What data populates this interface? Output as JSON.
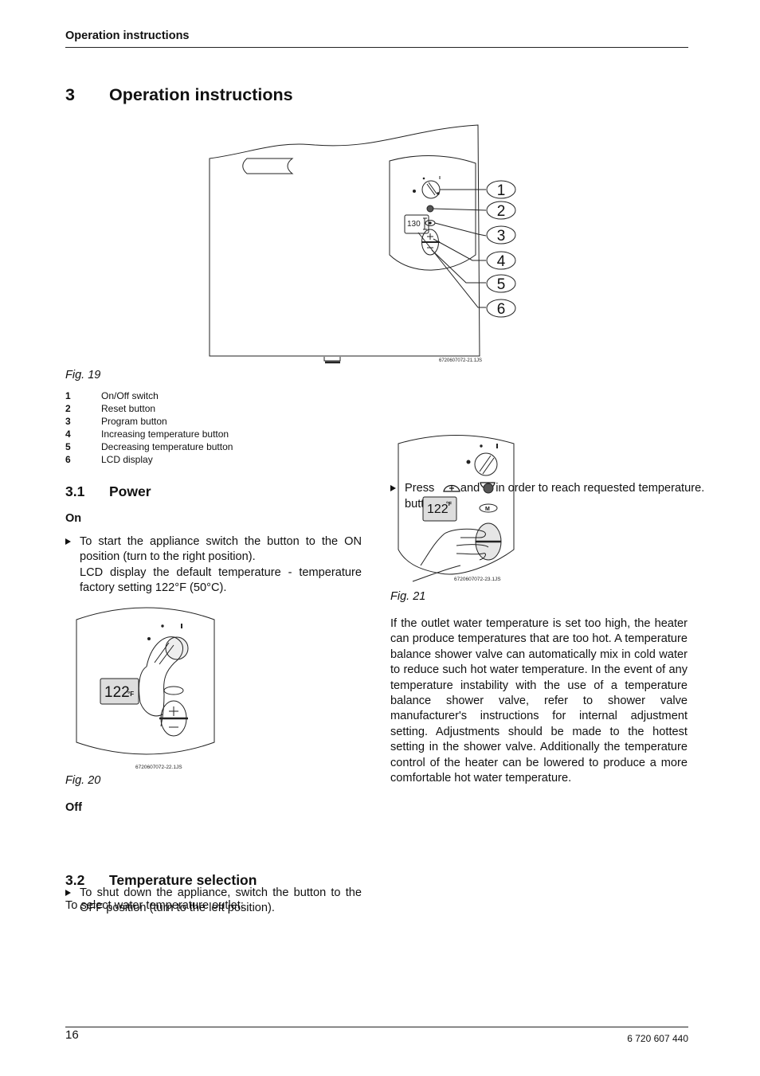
{
  "header": {
    "running_title": "Operation instructions"
  },
  "chapter": {
    "number": "3",
    "title": "Operation instructions"
  },
  "fig19": {
    "caption": "Fig. 19",
    "code": "6720607072-21.1JS",
    "lcd_value": "130",
    "callouts": [
      "1",
      "2",
      "3",
      "4",
      "5",
      "6"
    ],
    "legend": [
      {
        "key": "1",
        "label": "On/Off switch"
      },
      {
        "key": "2",
        "label": "Reset button"
      },
      {
        "key": "3",
        "label": "Program button"
      },
      {
        "key": "4",
        "label": "Increasing temperature button"
      },
      {
        "key": "5",
        "label": "Decreasing temperature button"
      },
      {
        "key": "6",
        "label": "LCD display"
      }
    ]
  },
  "section_3_1": {
    "number": "3.1",
    "title": "Power",
    "on": {
      "heading": "On",
      "bullet": "To start the appliance switch the button to the ON position (turn to the right position).",
      "note": "LCD display the default temperature - temperature factory setting 122°F (50°C)."
    },
    "fig20": {
      "caption": "Fig. 20",
      "code": "6720607072-22.1JS",
      "lcd_value": "122",
      "lcd_unit": "°F"
    },
    "off": {
      "heading": "Off",
      "bullet": "To shut down the appliance, switch the button to the OFF position (turn to the left position)."
    }
  },
  "section_3_2": {
    "number": "3.2",
    "title": "Temperature selection",
    "intro": "To select water temperature outlet:",
    "bullet_pre": "Press buttons",
    "bullet_icon1": "plus-button-icon",
    "bullet_and": "and",
    "bullet_icon2": "minus-button-icon",
    "bullet_post": "in order to reach requested temperature.",
    "fig21": {
      "caption": "Fig. 21",
      "code": "6720607072-23.1JS",
      "lcd_value": "122",
      "lcd_unit": "°F"
    },
    "paragraph": "If the outlet water temperature is set too high, the heater can produce temperatures that are too hot. A temperature balance shower valve can automatically mix in cold water to reduce such hot water temperature. In the event of any temperature instability with the use of a temperature balance shower valve, refer to shower valve manufacturer's instructions for internal adjustment setting. Adjustments should be made to the hottest setting in the shower valve. Additionally the temperature control of the heater can be lowered to produce a more comfortable hot water temperature."
  },
  "footer": {
    "page_number": "16",
    "doc_number": "6 720 607 440"
  }
}
